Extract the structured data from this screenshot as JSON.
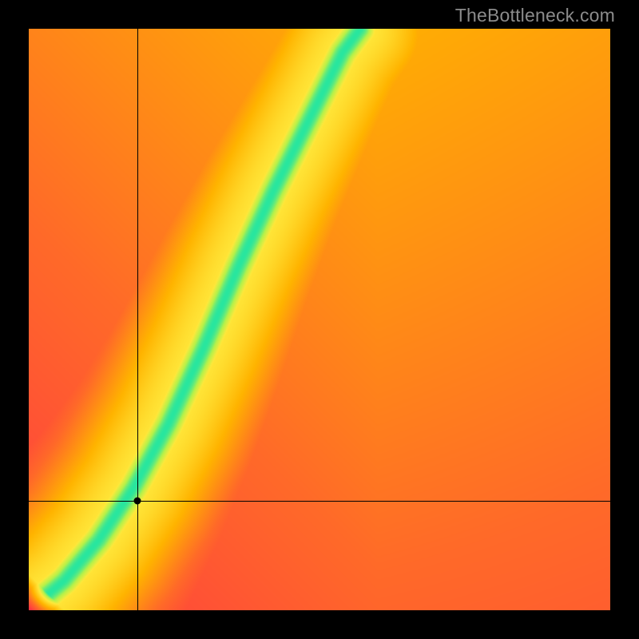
{
  "watermark": "TheBottleneck.com",
  "chart_data": {
    "type": "heatmap",
    "title": "",
    "xlabel": "",
    "ylabel": "",
    "x_range": [
      0,
      1
    ],
    "y_range": [
      0,
      1
    ],
    "grid": false,
    "colormap": {
      "stops": [
        {
          "t": 0.0,
          "color": "#ff2a4a"
        },
        {
          "t": 0.3,
          "color": "#ff6a29"
        },
        {
          "t": 0.55,
          "color": "#ffb400"
        },
        {
          "t": 0.78,
          "color": "#ffe93c"
        },
        {
          "t": 0.9,
          "color": "#b7f24a"
        },
        {
          "t": 1.0,
          "color": "#28e6a0"
        }
      ]
    },
    "ridge": {
      "description": "Approximate centerline of the green optimal band in normalized (x,y) coords, y from bottom.",
      "points": [
        {
          "x": 0.0,
          "y": 0.0
        },
        {
          "x": 0.06,
          "y": 0.05
        },
        {
          "x": 0.12,
          "y": 0.12
        },
        {
          "x": 0.18,
          "y": 0.21
        },
        {
          "x": 0.24,
          "y": 0.32
        },
        {
          "x": 0.3,
          "y": 0.45
        },
        {
          "x": 0.36,
          "y": 0.59
        },
        {
          "x": 0.42,
          "y": 0.72
        },
        {
          "x": 0.48,
          "y": 0.84
        },
        {
          "x": 0.54,
          "y": 0.96
        },
        {
          "x": 0.57,
          "y": 1.0
        }
      ],
      "half_width": 0.035
    },
    "background_bias": {
      "description": "Warm-vs-cool bias field: right/top area trends orange/yellow, left/bottom trends red.",
      "bottom_left": 0.05,
      "top_right": 0.58,
      "falloff": 0.75
    },
    "crosshair": {
      "x": 0.187,
      "y": 0.188,
      "note": "Normalized coords of black marker; y from bottom."
    }
  }
}
